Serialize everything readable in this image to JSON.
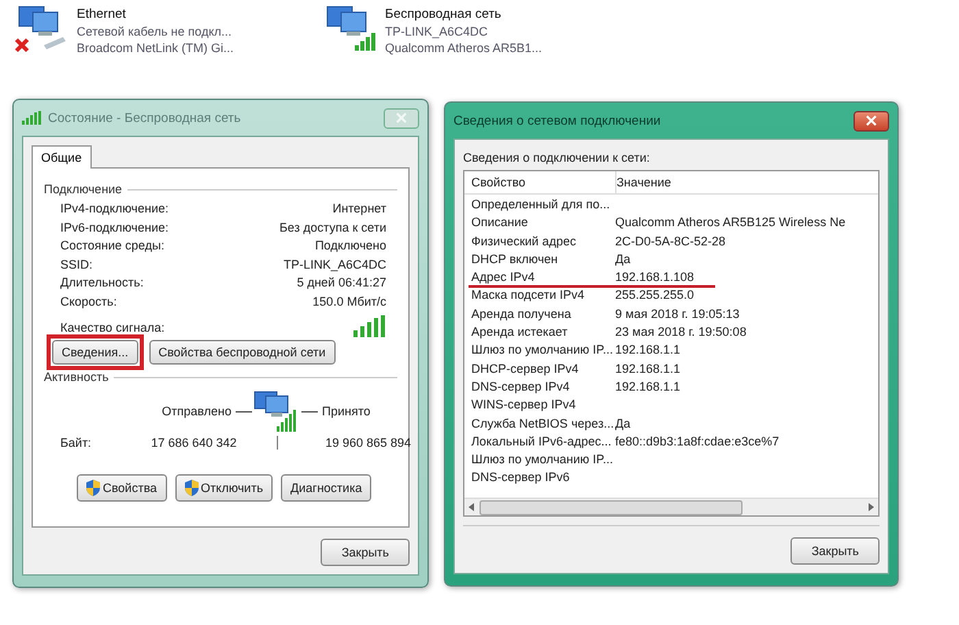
{
  "adapters": [
    {
      "kind": "ethernet",
      "name": "Ethernet",
      "status": "Сетевой кабель не подкл...",
      "device": "Broadcom NetLink (TM) Gi...",
      "connected": false
    },
    {
      "kind": "wireless",
      "name": "Беспроводная сеть",
      "status": "TP-LINK_A6C4DC",
      "device": "Qualcomm Atheros AR5B1...",
      "connected": true
    }
  ],
  "status_window": {
    "title": "Состояние - Беспроводная сеть",
    "close_enabled": false,
    "tabs": [
      {
        "label": "Общие",
        "selected": true
      }
    ],
    "connection": {
      "heading": "Подключение",
      "rows": [
        {
          "label": "IPv4-подключение:",
          "value": "Интернет"
        },
        {
          "label": "IPv6-подключение:",
          "value": "Без доступа к сети"
        },
        {
          "label": "Состояние среды:",
          "value": "Подключено"
        },
        {
          "label": "SSID:",
          "value": "TP-LINK_A6C4DC"
        },
        {
          "label": "Длительность:",
          "value": "5 дней 06:41:27"
        },
        {
          "label": "Скорость:",
          "value": "150.0 Мбит/с"
        }
      ],
      "signal_label": "Качество сигнала:",
      "buttons": [
        {
          "label": "Сведения...",
          "highlighted": true
        },
        {
          "label": "Свойства беспроводной сети",
          "highlighted": false
        }
      ]
    },
    "activity": {
      "heading": "Активность",
      "sent_label": "Отправлено",
      "received_label": "Принято",
      "bytes_label": "Байт:",
      "sent": "17 686 640 342",
      "received": "19 960 865 894"
    },
    "buttons": [
      {
        "label": "Свойства",
        "shield": true
      },
      {
        "label": "Отключить",
        "shield": true
      },
      {
        "label": "Диагностика",
        "shield": false
      }
    ],
    "close_button": "Закрыть"
  },
  "details_window": {
    "title": "Сведения о сетевом подключении",
    "close_enabled": true,
    "caption": "Сведения о подключении к сети:",
    "columns": [
      "Свойство",
      "Значение"
    ],
    "rows": [
      {
        "property": "Определенный для по...",
        "value": "",
        "underlined": false
      },
      {
        "property": "Описание",
        "value": "Qualcomm Atheros AR5B125 Wireless Ne",
        "underlined": false
      },
      {
        "property": "Физический адрес",
        "value": "2C-D0-5A-8C-52-28",
        "underlined": false
      },
      {
        "property": "DHCP включен",
        "value": "Да",
        "underlined": false
      },
      {
        "property": "Адрес IPv4",
        "value": "192.168.1.108",
        "underlined": true
      },
      {
        "property": "Маска подсети IPv4",
        "value": "255.255.255.0",
        "underlined": false
      },
      {
        "property": "Аренда получена",
        "value": "9 мая 2018 г. 19:05:13",
        "underlined": false
      },
      {
        "property": "Аренда истекает",
        "value": "23 мая 2018 г. 19:50:08",
        "underlined": false
      },
      {
        "property": "Шлюз по умолчанию IP...",
        "value": "192.168.1.1",
        "underlined": false
      },
      {
        "property": "DHCP-сервер IPv4",
        "value": "192.168.1.1",
        "underlined": false
      },
      {
        "property": "DNS-сервер IPv4",
        "value": "192.168.1.1",
        "underlined": false
      },
      {
        "property": "WINS-сервер IPv4",
        "value": "",
        "underlined": false
      },
      {
        "property": "Служба NetBIOS через...",
        "value": "Да",
        "underlined": false
      },
      {
        "property": "Локальный IPv6-адрес...",
        "value": "fe80::d9b3:1a8f:cdae:e3ce%7",
        "underlined": false
      },
      {
        "property": "Шлюз по умолчанию IP...",
        "value": "",
        "underlined": false
      },
      {
        "property": "DNS-сервер IPv6",
        "value": "",
        "underlined": false
      }
    ],
    "close_button": "Закрыть"
  }
}
